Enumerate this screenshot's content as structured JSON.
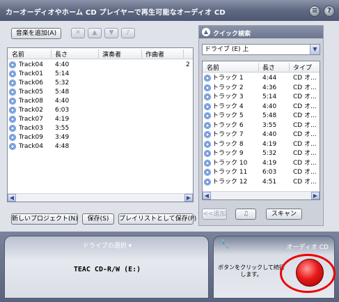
{
  "window": {
    "title": "カーオーディオやホーム CD プレイヤーで再生可能なオーディオ CD",
    "minimize_icon": "collapse-icon",
    "help_label": "?"
  },
  "toolbar": {
    "add_music_label": "音楽を追加(A)"
  },
  "track_list": {
    "columns": [
      "名前",
      "長さ",
      "演奏者",
      "作曲者"
    ],
    "extra_value": "2",
    "rows": [
      {
        "name": "Track04",
        "length": "4:40"
      },
      {
        "name": "Track01",
        "length": "5:14"
      },
      {
        "name": "Track06",
        "length": "5:32"
      },
      {
        "name": "Track05",
        "length": "5:48"
      },
      {
        "name": "Track08",
        "length": "4:40"
      },
      {
        "name": "Track02",
        "length": "6:03"
      },
      {
        "name": "Track07",
        "length": "4:19"
      },
      {
        "name": "Track03",
        "length": "3:55"
      },
      {
        "name": "Track09",
        "length": "3:49"
      },
      {
        "name": "Track04",
        "length": "4:48"
      }
    ]
  },
  "bottom_buttons": {
    "new_project": "新しいプロジェクト(N)",
    "save": "保存(S)",
    "save_as_playlist": "プレイリストとして保存(P)"
  },
  "quick_search": {
    "title": "クイック検索",
    "drive_selected": "ドライブ (E) 上",
    "columns": [
      "名前",
      "長さ",
      "タイプ"
    ],
    "rows": [
      {
        "name": "トラック 1",
        "length": "4:44",
        "type": "CD オ..."
      },
      {
        "name": "トラック 2",
        "length": "4:36",
        "type": "CD オ..."
      },
      {
        "name": "トラック 3",
        "length": "5:14",
        "type": "CD オ..."
      },
      {
        "name": "トラック 4",
        "length": "4:40",
        "type": "CD オ..."
      },
      {
        "name": "トラック 5",
        "length": "5:48",
        "type": "CD オ..."
      },
      {
        "name": "トラック 6",
        "length": "3:55",
        "type": "CD オ..."
      },
      {
        "name": "トラック 7",
        "length": "4:40",
        "type": "CD オ..."
      },
      {
        "name": "トラック 8",
        "length": "4:19",
        "type": "CD オ..."
      },
      {
        "name": "トラック 9",
        "length": "5:32",
        "type": "CD オ..."
      },
      {
        "name": "トラック 10",
        "length": "4:19",
        "type": "CD オ..."
      },
      {
        "name": "トラック 11",
        "length": "6:03",
        "type": "CD オ..."
      },
      {
        "name": "トラック 12",
        "length": "4:51",
        "type": "CD オ..."
      }
    ],
    "add_label": "<<追加",
    "scan_label": "スキャン"
  },
  "drive_section": {
    "label": "ドライブの選択",
    "drive_name": "TEAC CD-R/W (E:)"
  },
  "audio_section": {
    "label": "オーディオ CD",
    "instruction": "ボタンをクリックして続行します。"
  }
}
